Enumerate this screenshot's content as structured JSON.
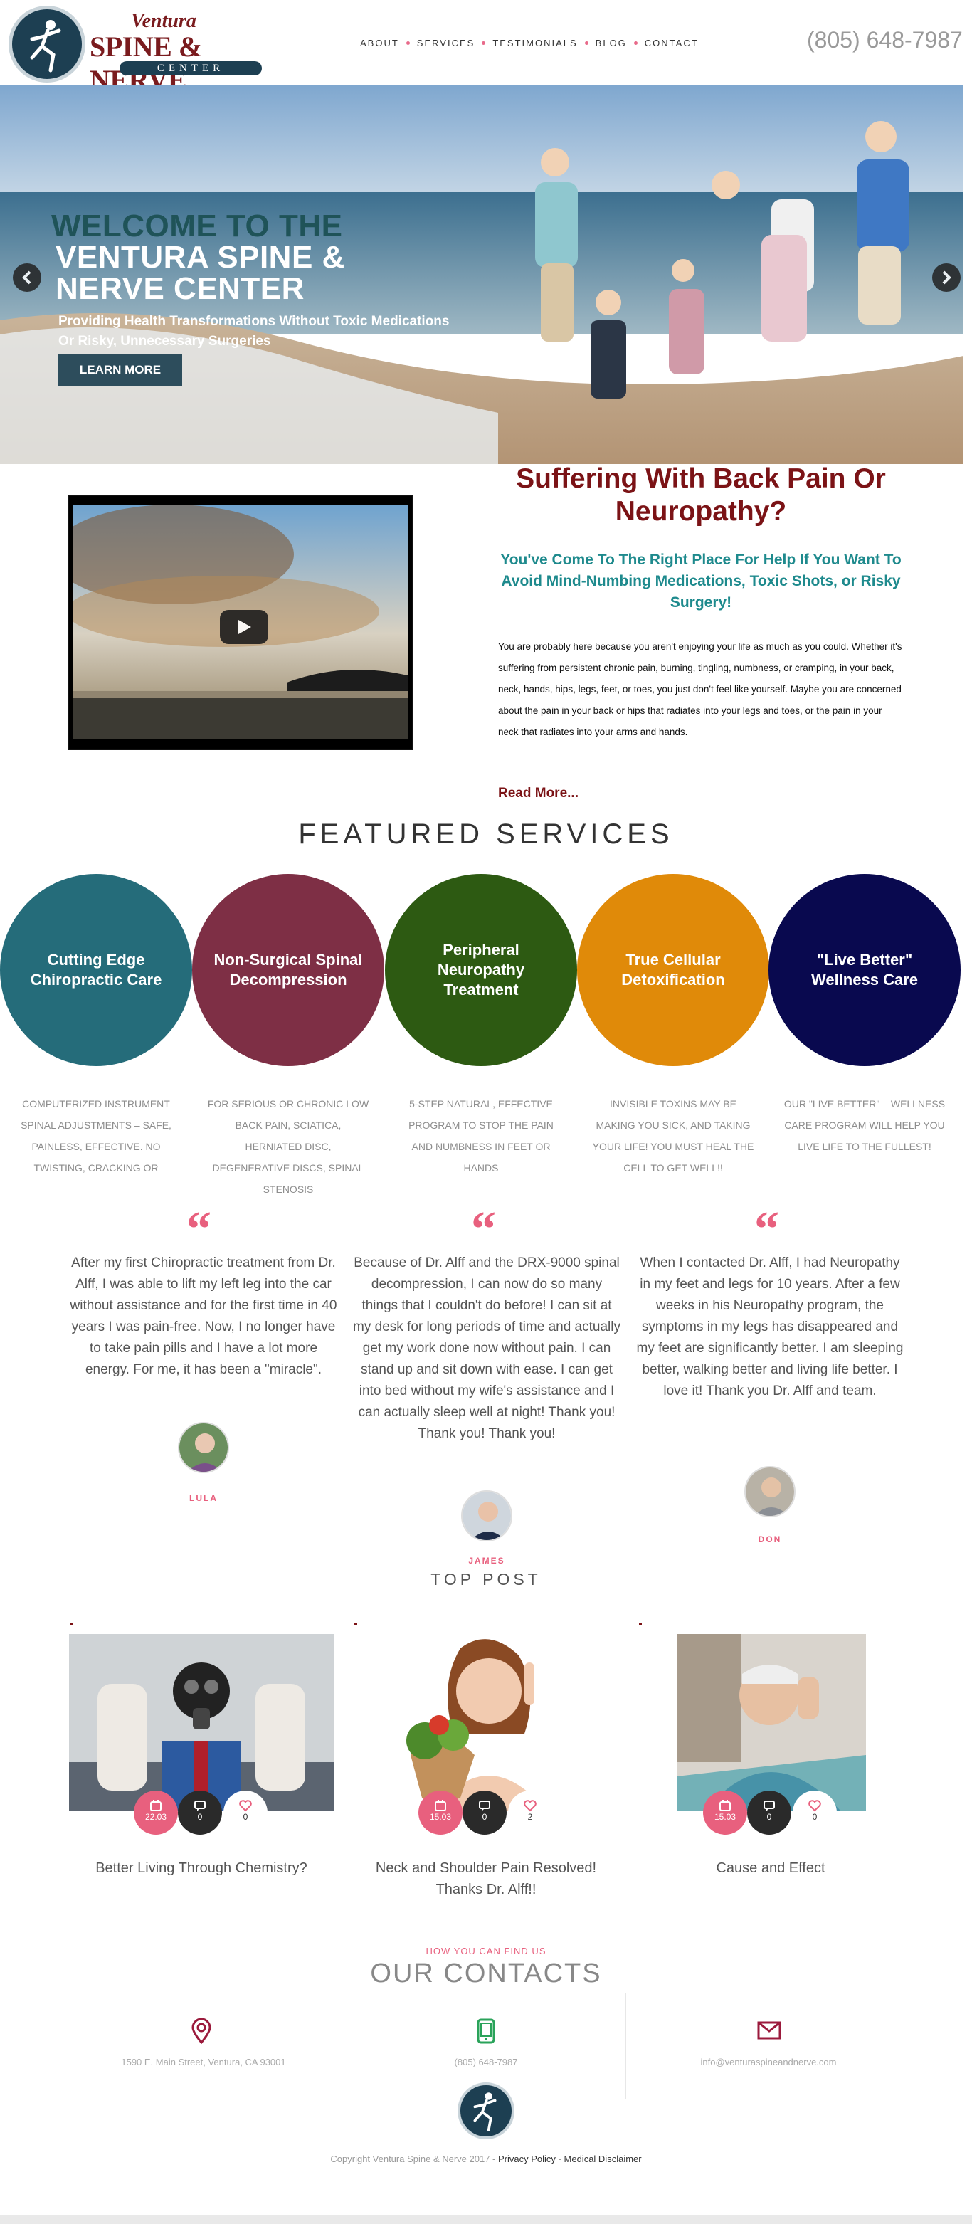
{
  "header": {
    "logo_top": "Ventura",
    "logo_middle": "SPINE & NERVE",
    "logo_bottom": "CENTER",
    "nav": [
      "ABOUT",
      "SERVICES",
      "TESTIMONIALS",
      "BLOG",
      "CONTACT"
    ],
    "phone": "(805) 648-7987"
  },
  "hero": {
    "line1": "WELCOME TO THE",
    "line2": "VENTURA SPINE &",
    "line3": "NERVE CENTER",
    "subtitle_1": "Providing Health Transformations Without Toxic Medications",
    "subtitle_2": "Or Risky, Unnecessary Surgeries",
    "button": "LEARN MORE"
  },
  "intro": {
    "title": "Suffering With Back Pain Or Neuropathy?",
    "subtitle": "You've Come To The Right Place For Help If You Want To Avoid Mind-Numbing Medications, Toxic Shots, or Risky Surgery!",
    "body": "You are probably here because you aren't enjoying your life as much as you could. Whether it's suffering from persistent chronic pain, burning, tingling, numbness, or cramping, in your back, neck, hands, hips, legs, feet, or toes, you just don't feel like yourself. Maybe you are concerned about the pain in your back or hips that radiates into your legs and toes, or the pain in your neck that radiates into your arms and hands.",
    "read_more": "Read More..."
  },
  "featured": {
    "title": "FEATURED SERVICES",
    "services": [
      {
        "title": "Cutting Edge Chiropractic Care",
        "color": "#256c7a",
        "desc": "Computerized instrument spinal adjustments – safe, painless, effective. No twisting, cracking or"
      },
      {
        "title": "Non-Surgical Spinal Decompression",
        "color": "#7e2f45",
        "desc": "For serious or chronic low back pain, sciatica, herniated disc, degenerative discs, spinal stenosis"
      },
      {
        "title": "Peripheral Neuropathy Treatment",
        "color": "#2d5a12",
        "desc": "5-step natural, effective program to stop the pain and numbness in feet or hands"
      },
      {
        "title": "True Cellular Detoxification",
        "color": "#e08a09",
        "desc": "Invisible toxins may be making you sick, and taking your life! You must heal the cell to get well!!"
      },
      {
        "title": "\"Live Better\" Wellness Care",
        "color": "#09094f",
        "desc": "Our \"Live Better\" – Wellness Care Program will help you live life to the fullest!"
      }
    ]
  },
  "testimonials": [
    {
      "quote": "“",
      "text": "After my first Chiropractic treatment from Dr. Alff, I was able to lift my left leg into the car without assistance and for the first time in 40 years I was pain-free. Now, I no longer have to take pain pills and I have a lot more energy. For me, it has been a \"miracle\".",
      "name": "LULA"
    },
    {
      "quote": "“",
      "text": "Because of Dr. Alff and the DRX-9000 spinal decompression, I can now do so many things that I couldn't do before! I can sit at my desk for long periods of time and actually get my work done now without pain. I can stand up and sit down with ease. I can get into bed without my wife's assistance and I can actually sleep well at night! Thank you! Thank you! Thank you!",
      "name": "JAMES"
    },
    {
      "quote": "“",
      "text": "When I contacted Dr. Alff, I had Neuropathy in my feet and legs for 10 years. After a few weeks in his Neuropathy program, the symptoms in my legs has disappeared and my feet are significantly better. I am sleeping better, walking better and living life better. I love it! Thank you Dr. Alff and team.",
      "name": "DON"
    }
  ],
  "posts": {
    "title": "TOP POST",
    "items": [
      {
        "date": "22.03",
        "comments": "0",
        "likes": "0",
        "title": "Better Living Through Chemistry?"
      },
      {
        "date": "15.03",
        "comments": "0",
        "likes": "2",
        "title": "Neck and Shoulder Pain Resolved! Thanks Dr. Alff!!"
      },
      {
        "date": "15.03",
        "comments": "0",
        "likes": "0",
        "title": "Cause and Effect"
      }
    ]
  },
  "contacts": {
    "kicker": "HOW YOU CAN FIND US",
    "title": "OUR CONTACTS",
    "address": "1590 E. Main Street, Ventura, CA 93001",
    "phone": "(805) 648-7987",
    "email": "info@venturaspineandnerve.com"
  },
  "footer": {
    "copyright": "Copyright Ventura Spine & Nerve 2017 -",
    "privacy": "Privacy Policy",
    "separator": "-",
    "disclaimer": "Medical Disclaimer"
  },
  "colors": {
    "brand_red": "#7b1316",
    "teal": "#1e8a8d",
    "accent_pink": "#e8607e",
    "navy": "#1d3f52"
  }
}
